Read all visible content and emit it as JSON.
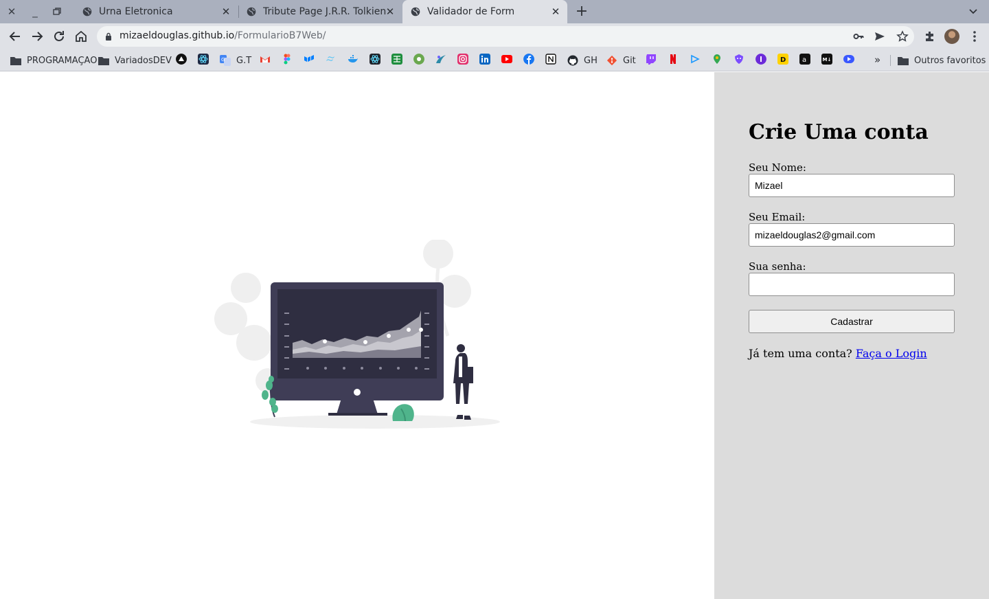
{
  "window": {
    "tabs": [
      {
        "title": "Urna Eletronica",
        "active": false
      },
      {
        "title": "Tribute Page J.R.R. Tolkien",
        "active": false
      },
      {
        "title": "Validador de Form",
        "active": true
      }
    ]
  },
  "toolbar": {
    "url_host": "mizaeldouglas.github.io",
    "url_path": "/FormularioB7Web/"
  },
  "bookmarks": {
    "folders": [
      "PROGRAMAÇAO",
      "VariadosDEV"
    ],
    "labeled": [
      "G.T",
      "GH",
      "Git"
    ],
    "other": "Outros favoritos",
    "more": "»"
  },
  "form": {
    "title": "Crie Uma conta",
    "name_label": "Seu Nome:",
    "name_value": "Mizael",
    "email_label": "Seu Email:",
    "email_value": "mizaeldouglas2@gmail.com",
    "password_label": "Sua senha:",
    "password_value": "",
    "submit_label": "Cadastrar",
    "login_prompt": "Já tem uma conta?",
    "login_link": "Faça o Login"
  },
  "colors": {
    "panel_bg": "#dcdcdc",
    "accent_green": "#4fb48b",
    "monitor": "#3f3d56",
    "link": "#0000ee"
  }
}
